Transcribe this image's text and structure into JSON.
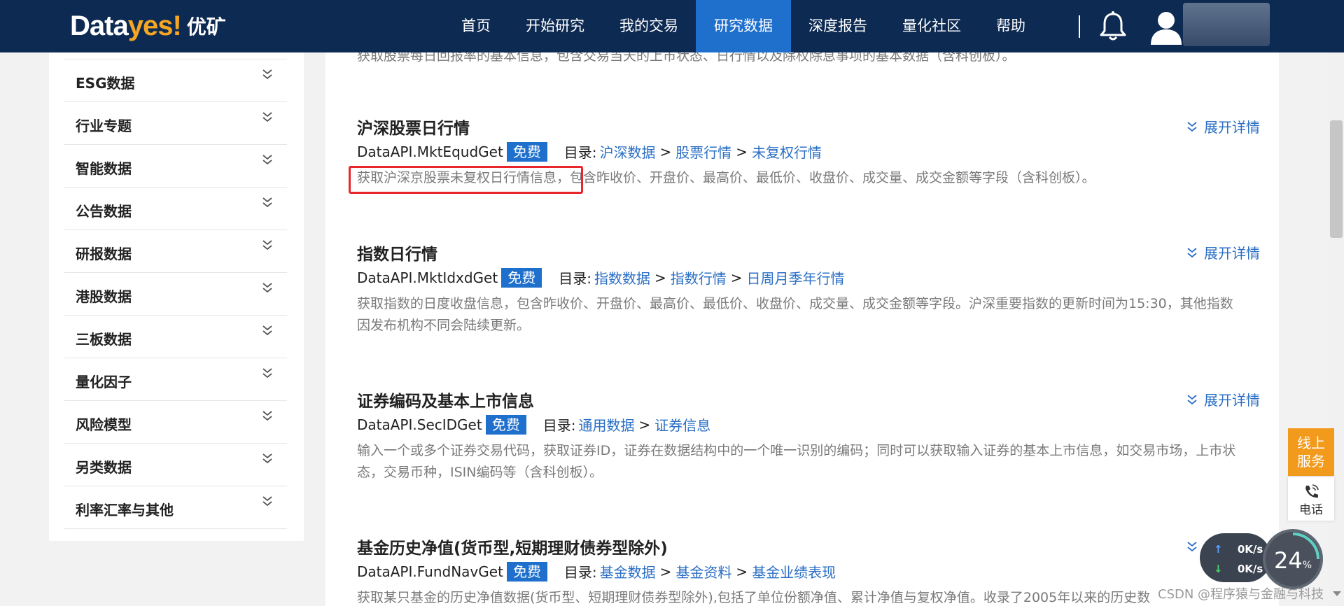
{
  "brand": {
    "logo_main": "Data",
    "logo_accent": "yes!",
    "logo_cn": "优矿"
  },
  "nav": {
    "items": [
      {
        "label": "首页"
      },
      {
        "label": "开始研究"
      },
      {
        "label": "我的交易"
      },
      {
        "label": "研究数据",
        "active": true
      },
      {
        "label": "深度报告"
      },
      {
        "label": "量化社区"
      },
      {
        "label": "帮助"
      }
    ],
    "bell_icon": "bell-icon",
    "avatar_icon": "user-avatar-icon"
  },
  "sidebar": {
    "items": [
      {
        "label": "ESG数据"
      },
      {
        "label": "行业专题"
      },
      {
        "label": "智能数据"
      },
      {
        "label": "公告数据"
      },
      {
        "label": "研报数据"
      },
      {
        "label": "港股数据"
      },
      {
        "label": "三板数据"
      },
      {
        "label": "量化因子"
      },
      {
        "label": "风险模型"
      },
      {
        "label": "另类数据"
      },
      {
        "label": "利率汇率与其他"
      }
    ]
  },
  "main": {
    "top_description": "获取股票每日回报率的基本信息，包含交易当天的上市状态、日行情以及除权除息事项的基本数据（含科创板）。",
    "expand_label": "展开详情",
    "free_badge": "免费",
    "catalog_prefix": "目录:",
    "separator": ">",
    "entries": [
      {
        "title": "沪深股票日行情",
        "api": "DataAPI.MktEqudGet",
        "catalog": [
          "沪深数据",
          "股票行情",
          "未复权行情"
        ],
        "description": "获取沪深京股票未复权日行情信息，包含昨收价、开盘价、最高价、最低价、收盘价、成交量、成交金额等字段（含科创板）。"
      },
      {
        "title": "指数日行情",
        "api": "DataAPI.MktIdxdGet",
        "catalog": [
          "指数数据",
          "指数行情",
          "日周月季年行情"
        ],
        "description": "获取指数的日度收盘信息，包含昨收价、开盘价、最高价、最低价、收盘价、成交量、成交金额等字段。沪深重要指数的更新时间为15:30，其他指数因发布机构不同会陆续更新。"
      },
      {
        "title": "证券编码及基本上市信息",
        "api": "DataAPI.SecIDGet",
        "catalog": [
          "通用数据",
          "证券信息"
        ],
        "description": "输入一个或多个证券交易代码，获取证券ID，证券在数据结构中的一个唯一识别的编码；同时可以获取输入证券的基本上市信息，如交易市场，上市状态，交易币种，ISIN编码等（含科创板）。"
      },
      {
        "title": "基金历史净值(货币型,短期理财债券型除外)",
        "api": "DataAPI.FundNavGet",
        "catalog": [
          "基金数据",
          "基金资料",
          "基金业绩表现"
        ],
        "description": "获取某只基金的历史净值数据(货币型、短期理财债券型除外),包括了单位份额净值、累计净值与复权净值。收录了2005年以来的历史数"
      }
    ]
  },
  "widgets": {
    "online_service": "线上服务",
    "phone_label": "电话",
    "upload_speed": "0K/s",
    "download_speed": "0K/s",
    "gauge_value": "24",
    "gauge_unit": "%",
    "watermark": "CSDN @程序猿与金融与科技"
  },
  "colors": {
    "nav_bg": "#0d2a52",
    "accent": "#1f6fcc",
    "link": "#2b6fc5",
    "highlight": "#e8262b",
    "logo_accent": "#f5a623"
  }
}
